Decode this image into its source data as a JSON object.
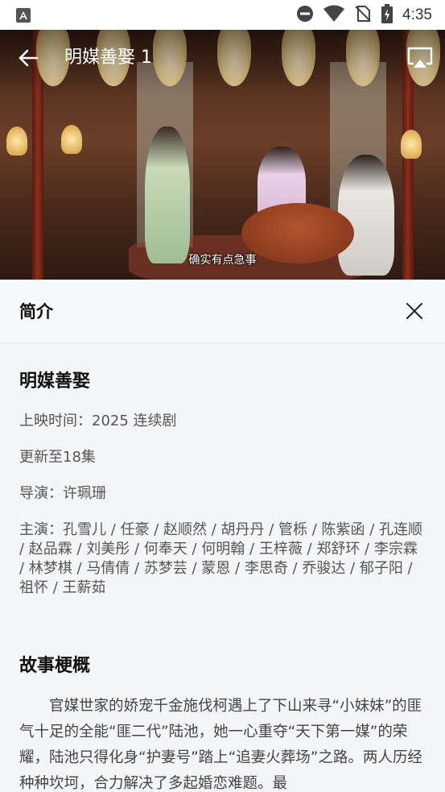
{
  "status_bar": {
    "time": "4:35",
    "icons": [
      "app-notification-icon",
      "do-not-disturb-icon",
      "wifi-icon",
      "no-sim-icon",
      "battery-charging-icon"
    ]
  },
  "player": {
    "title": "明媒善娶 1",
    "subtitle": "确实有点急事",
    "icons": [
      "back-arrow-icon",
      "cast-screen-icon"
    ]
  },
  "intro": {
    "header": "简介",
    "close_icon": "close-icon"
  },
  "drama": {
    "title": "明媒善娶",
    "release": "上映时间：2025  连续剧",
    "update": "更新至18集",
    "director": "导演：许珮珊",
    "cast": "主演：孔雪儿 / 任豪 / 赵顺然 / 胡丹丹 / 管栎 / 陈紫函 / 孔连顺 / 赵品霖 / 刘美彤 / 何奉天 / 何明翰 / 王梓薇 / 郑舒环 / 李宗霖 / 林梦棋 / 马倩倩 / 苏梦芸 / 蒙恩 / 李思奇 / 乔骏达 / 郁子阳 / 祖怀 / 王薪茹"
  },
  "synopsis": {
    "title": "故事梗概",
    "text": "官媒世家的娇宠千金施伐柯遇上了下山来寻“小妹妹”的匪气十足的全能“匪二代”陆池，她一心重夺“天下第一媒”的荣耀，陆池只得化身“护妻号”踏上“追妻火葬场”之路。两人历经种种坎坷，合力解决了多起婚恋难题。最"
  },
  "colors": {
    "accent": "#111111",
    "background": "#f4f5f7",
    "header_bg": "#f7f8fa"
  }
}
